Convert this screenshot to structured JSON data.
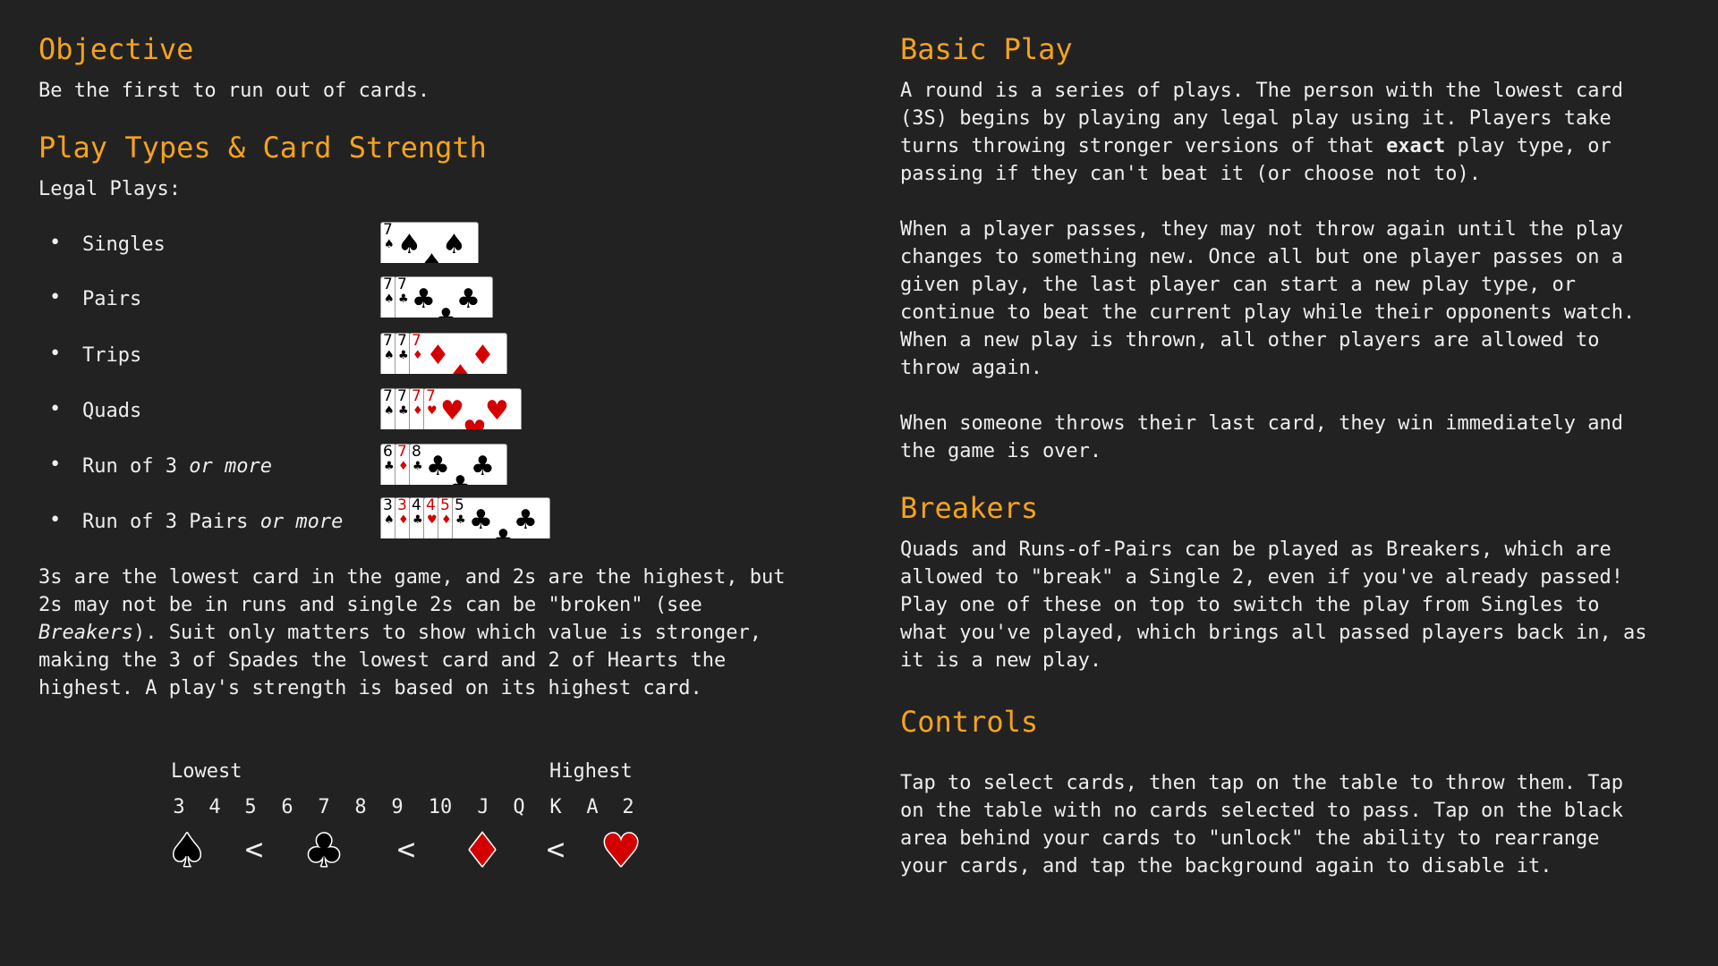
{
  "left": {
    "objective_heading": "Objective",
    "objective_text": "Be the first to run out of cards.",
    "play_types_heading": "Play Types & Card Strength",
    "legal_plays_label": "Legal Plays:",
    "plays": [
      {
        "label": "Singles",
        "italic": "",
        "cards": [
          {
            "rank": "7",
            "suit": "♠"
          }
        ]
      },
      {
        "label": "Pairs",
        "italic": "",
        "cards": [
          {
            "rank": "7",
            "suit": "♠"
          },
          {
            "rank": "7",
            "suit": "♣"
          }
        ]
      },
      {
        "label": "Trips",
        "italic": "",
        "cards": [
          {
            "rank": "7",
            "suit": "♠"
          },
          {
            "rank": "7",
            "suit": "♣"
          },
          {
            "rank": "7",
            "suit": "♦"
          }
        ]
      },
      {
        "label": "Quads",
        "italic": "",
        "cards": [
          {
            "rank": "7",
            "suit": "♠"
          },
          {
            "rank": "7",
            "suit": "♣"
          },
          {
            "rank": "7",
            "suit": "♦"
          },
          {
            "rank": "7",
            "suit": "♥"
          }
        ]
      },
      {
        "label": "Run of 3 ",
        "italic": "or more",
        "cards": [
          {
            "rank": "6",
            "suit": "♣"
          },
          {
            "rank": "7",
            "suit": "♦"
          },
          {
            "rank": "8",
            "suit": "♣"
          }
        ]
      },
      {
        "label": "Run of 3 Pairs ",
        "italic": "or more",
        "cards": [
          {
            "rank": "3",
            "suit": "♠"
          },
          {
            "rank": "3",
            "suit": "♦"
          },
          {
            "rank": "4",
            "suit": "♣"
          },
          {
            "rank": "4",
            "suit": "♥"
          },
          {
            "rank": "5",
            "suit": "♦"
          },
          {
            "rank": "5",
            "suit": "♣"
          }
        ]
      }
    ],
    "strength_lines": [
      "3s are the lowest card in the game, and 2s are the highest, but",
      "2s may not be in runs and single 2s can be \"broken\" (see",
      "Breakers",
      "). Suit only matters to show which value is stronger,",
      "making the 3 of Spades the lowest card and 2 of Hearts the",
      "highest. A play's strength is based on its highest card."
    ],
    "scale": {
      "lowest_label": "Lowest",
      "highest_label": "Highest",
      "ranks": [
        "3",
        "4",
        "5",
        "6",
        "7",
        "8",
        "9",
        "10",
        "J",
        "Q",
        "K",
        "A",
        "2"
      ],
      "suits": [
        "♠",
        "♣",
        "♦",
        "♥"
      ],
      "separator": "<"
    }
  },
  "right": {
    "basic_play_heading": "Basic Play",
    "basic_play_p1": [
      "A round is a series of plays. The person with the lowest card",
      "(3S) begins by playing any legal play using it. Players take",
      "turns throwing stronger versions of that ",
      "exact",
      " play type, or",
      "passing if they can't beat it (or choose not to)."
    ],
    "basic_play_p2": [
      "When a player passes, they may not throw again until the play",
      "changes to something new. Once all but one player passes on a",
      "given play, the last player can start a new play type, or",
      "continue to beat the current play while their opponents watch.",
      "When a new play is thrown, all other players are allowed to",
      "throw again."
    ],
    "basic_play_p3": [
      "When someone throws their last card, they win immediately and",
      "the game is over."
    ],
    "breakers_heading": "Breakers",
    "breakers_lines": [
      "Quads and Runs-of-Pairs can be played as Breakers, which are",
      "allowed to \"break\" a Single 2, even if you've already passed!",
      "Play one of these on top to switch the play from Singles to",
      "what you've played, which brings all passed players back in, as",
      "it is a new play."
    ],
    "controls_heading": "Controls",
    "controls_lines": [
      "Tap to select cards, then tap on the table to throw them. Tap",
      "on the table with no cards selected to pass. Tap on the black",
      "area behind your cards to \"unlock\" the ability to rearrange",
      "your cards, and tap the background again to disable it."
    ]
  },
  "colors": {
    "heading": "#f5a31c",
    "background": "#222222",
    "red_suit": "#d40000",
    "black_suit": "#000000"
  }
}
